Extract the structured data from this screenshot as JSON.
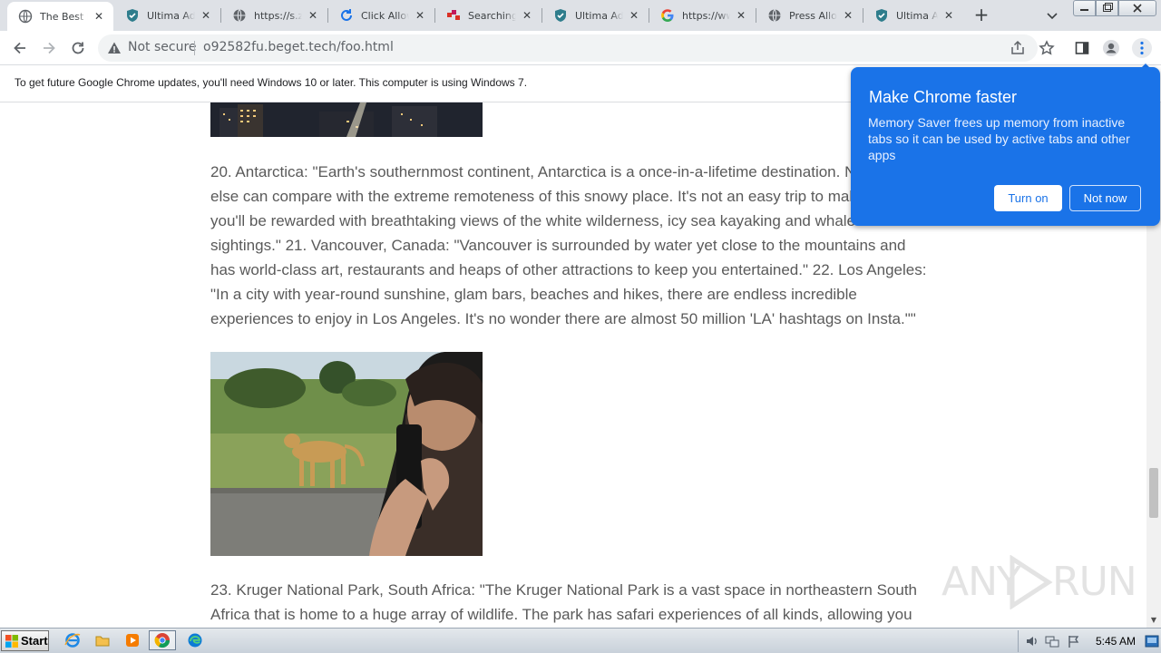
{
  "tabs": [
    {
      "title": "The Best Pl",
      "icon": "globe-icon",
      "active": true
    },
    {
      "title": "Ultima AdBl",
      "icon": "shield-icon",
      "active": false
    },
    {
      "title": "https://s.zi",
      "icon": "globe-icon",
      "active": false
    },
    {
      "title": "Click Allow",
      "icon": "refresh-icon",
      "active": false
    },
    {
      "title": "Searching f",
      "icon": "search-provider-icon",
      "active": false
    },
    {
      "title": "Ultima AdBl",
      "icon": "shield-icon",
      "active": false
    },
    {
      "title": "https://ww",
      "icon": "google-icon",
      "active": false
    },
    {
      "title": "Press Allow",
      "icon": "globe-icon",
      "active": false
    },
    {
      "title": "Ultima AdBl",
      "icon": "shield-icon",
      "active": false
    }
  ],
  "omnibox": {
    "security_label": "Not secure",
    "url": "o92582fu.beget.tech/foo.html"
  },
  "infobar": {
    "message": "To get future Google Chrome updates, you'll need Windows 10 or later. This computer is using Windows 7."
  },
  "promo": {
    "title": "Make Chrome faster",
    "body": "Memory Saver frees up memory from inactive tabs so it can be used by active tabs and other apps",
    "turn_on_label": "Turn on",
    "not_now_label": "Not now"
  },
  "article": {
    "paragraph_1": "20. Antarctica: \"Earth's southernmost continent, Antarctica is a once-in-a-lifetime destination. Nowhere else can compare with the extreme remoteness of this snowy place. It's not an easy trip to make, but you'll be rewarded with breathtaking views of the white wilderness, icy sea kayaking and whale sightings.\" 21. Vancouver, Canada: \"Vancouver is surrounded by water yet close to the mountains and has world-class art, restaurants and heaps of other attractions to keep you entertained.\" 22. Los Angeles: \"In a city with year-round sunshine, glam bars, beaches and hikes, there are endless incredible experiences to enjoy in Los Angeles. It's no wonder there are almost 50 million 'LA' hashtags on Insta.\"\"",
    "paragraph_2": "23. Kruger National Park, South Africa: \"The Kruger National Park is a vast space in northeastern South Africa that is home to a huge array of wildlife. The park has safari experiences of all kinds, allowing you"
  },
  "watermark": {
    "text_left": "ANY",
    "text_right": "RUN"
  },
  "taskbar": {
    "start_label": "Start",
    "clock": "5:45 AM"
  },
  "colors": {
    "accent": "#1a73e8",
    "tabstrip": "#dee1e6",
    "body_text": "#5a5a5a"
  }
}
